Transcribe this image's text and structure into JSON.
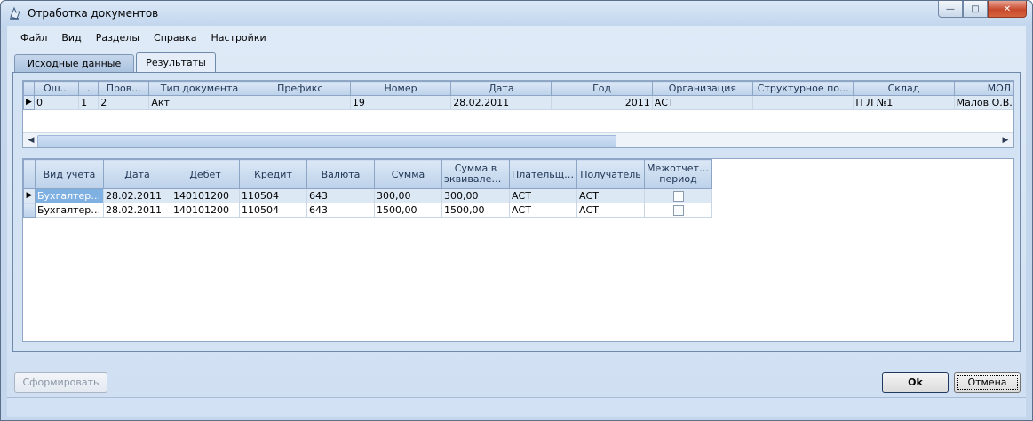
{
  "window": {
    "title": "Отработка документов"
  },
  "menu": [
    "Файл",
    "Вид",
    "Разделы",
    "Справка",
    "Настройки"
  ],
  "tabs": [
    "Исходные данные",
    "Результаты"
  ],
  "grid1": {
    "columns": [
      "Ош...",
      ".",
      "Пров...",
      "Тип документа",
      "Префикс",
      "Номер",
      "Дата",
      "Год",
      "Организация",
      "Структурное по...",
      "Склад",
      "МОЛ"
    ],
    "rows": [
      [
        "0",
        "1",
        "2",
        "Акт",
        "",
        "19",
        "28.02.2011",
        "2011",
        "АСТ",
        "",
        "П Л №1",
        "Малов О.В."
      ]
    ]
  },
  "grid2": {
    "columns": [
      "Вид учёта",
      "Дата",
      "Дебет",
      "Кредит",
      "Валюта",
      "Сумма",
      "Сумма в эквиваленте",
      "Плательщик",
      "Получатель",
      "Межотчетный период"
    ],
    "rows": [
      [
        "Бухгалтерс...",
        "28.02.2011",
        "140101200",
        "110504",
        "643",
        "300,00",
        "300,00",
        "АСТ",
        "АСТ"
      ],
      [
        "Бухгалтерс...",
        "28.02.2011",
        "140101200",
        "110504",
        "643",
        "1500,00",
        "1500,00",
        "АСТ",
        "АСТ"
      ]
    ]
  },
  "buttons": {
    "form": "Сформировать",
    "ok": "Ok",
    "cancel": "Отмена"
  },
  "icons": {
    "app": "document-app-icon",
    "minimize": "minimize-icon",
    "maximize": "maximize-icon",
    "close": "close-icon"
  }
}
